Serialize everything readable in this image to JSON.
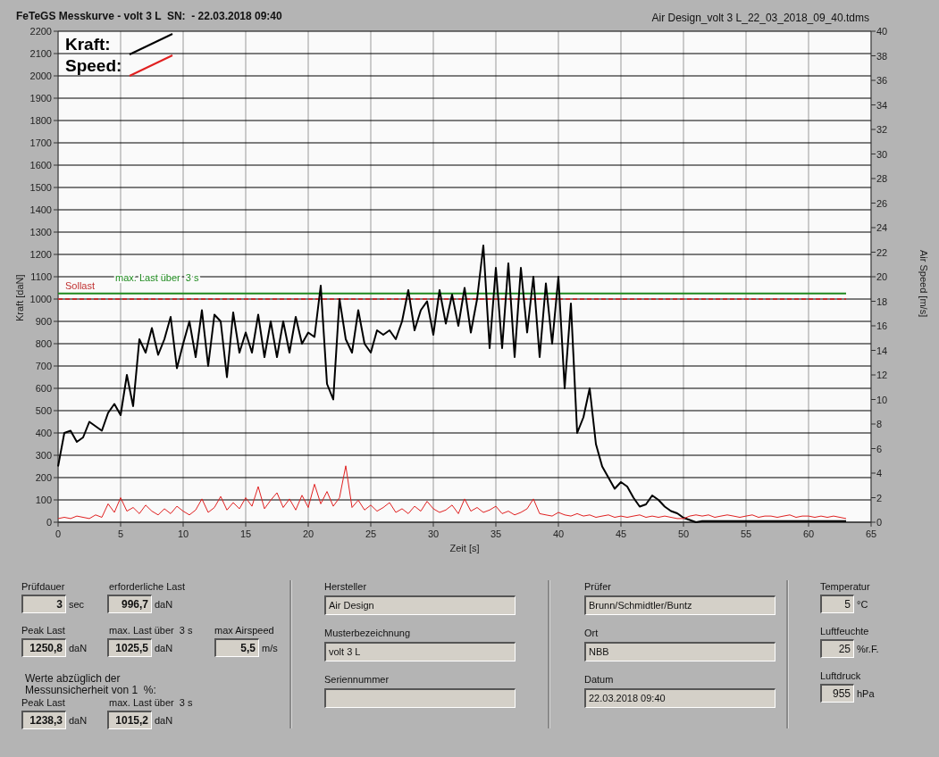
{
  "header": {
    "title": "FeTeGS Messkurve - volt 3 L  SN:  - 22.03.2018 09:40",
    "file": "Air Design_volt 3 L_22_03_2018_09_40.tdms"
  },
  "chart": {
    "chart_data": {
      "type": "line",
      "xlabel": "Zeit [s]",
      "ylabel": "Kraft [daN]",
      "y2label": "Air Speed [m/s]",
      "xlim": [
        0,
        65
      ],
      "ylim": [
        0,
        2200
      ],
      "y2lim": [
        0,
        40
      ],
      "xticks": [
        0,
        5,
        10,
        15,
        20,
        25,
        30,
        35,
        40,
        45,
        50,
        55,
        60,
        65
      ],
      "yticks": [
        0,
        100,
        200,
        300,
        400,
        500,
        600,
        700,
        800,
        900,
        1000,
        1100,
        1200,
        1300,
        1400,
        1500,
        1600,
        1700,
        1800,
        1900,
        2000,
        2100,
        2200
      ],
      "y2ticks": [
        0,
        2,
        4,
        6,
        8,
        10,
        12,
        14,
        16,
        18,
        20,
        22,
        24,
        26,
        28,
        30,
        32,
        34,
        36,
        38,
        40
      ],
      "x": [
        0,
        0.5,
        1,
        1.5,
        2,
        2.5,
        3,
        3.5,
        4,
        4.5,
        5,
        5.5,
        6,
        6.5,
        7,
        7.5,
        8,
        8.5,
        9,
        9.5,
        10,
        10.5,
        11,
        11.5,
        12,
        12.5,
        13,
        13.5,
        14,
        14.5,
        15,
        15.5,
        16,
        16.5,
        17,
        17.5,
        18,
        18.5,
        19,
        19.5,
        20,
        20.5,
        21,
        21.5,
        22,
        22.5,
        23,
        23.5,
        24,
        24.5,
        25,
        25.5,
        26,
        26.5,
        27,
        27.5,
        28,
        28.5,
        29,
        29.5,
        30,
        30.5,
        31,
        31.5,
        32,
        32.5,
        33,
        33.5,
        34,
        34.5,
        35,
        35.5,
        36,
        36.5,
        37,
        37.5,
        38,
        38.5,
        39,
        39.5,
        40,
        40.5,
        41,
        41.5,
        42,
        42.5,
        43,
        43.5,
        44,
        44.5,
        45,
        45.5,
        46,
        46.5,
        47,
        47.5,
        48,
        48.5,
        49,
        49.5,
        50,
        50.5,
        51,
        51.5,
        52,
        52.5,
        53,
        53.5,
        54,
        54.5,
        55,
        55.5,
        56,
        56.5,
        57,
        57.5,
        58,
        58.5,
        59,
        59.5,
        60,
        60.5,
        61,
        61.5,
        62,
        62.5,
        63
      ],
      "series": [
        {
          "name": "Kraft:",
          "color": "#000000",
          "values": [
            250,
            400,
            410,
            360,
            380,
            450,
            430,
            410,
            490,
            530,
            480,
            660,
            520,
            820,
            760,
            870,
            750,
            820,
            920,
            690,
            800,
            900,
            740,
            950,
            700,
            930,
            900,
            650,
            940,
            760,
            850,
            760,
            930,
            740,
            900,
            740,
            900,
            760,
            920,
            800,
            850,
            830,
            1060,
            620,
            550,
            1000,
            820,
            760,
            950,
            800,
            760,
            860,
            840,
            860,
            820,
            900,
            1040,
            860,
            950,
            990,
            840,
            1040,
            890,
            1020,
            880,
            1050,
            850,
            1000,
            1240,
            780,
            1140,
            780,
            1160,
            740,
            1140,
            850,
            1100,
            740,
            1070,
            800,
            1100,
            600,
            980,
            400,
            470,
            600,
            350,
            250,
            200,
            150,
            180,
            160,
            110,
            70,
            80,
            120,
            100,
            70,
            50,
            40,
            20,
            10,
            0,
            5,
            5,
            5,
            5,
            5,
            5,
            5,
            5,
            5,
            5,
            5,
            5,
            5,
            5,
            5,
            5,
            5,
            5,
            5,
            5,
            5,
            5,
            5,
            5
          ]
        },
        {
          "name": "Speed:",
          "color": "#e02020",
          "axis": "y2",
          "values": [
            0.3,
            0.4,
            0.3,
            0.5,
            0.4,
            0.3,
            0.6,
            0.4,
            1.5,
            0.8,
            2.0,
            0.9,
            1.2,
            0.7,
            1.4,
            0.9,
            0.6,
            1.1,
            0.7,
            1.3,
            0.9,
            0.6,
            1.0,
            1.9,
            0.8,
            1.2,
            2.1,
            1.0,
            1.6,
            1.1,
            2.0,
            1.3,
            2.9,
            1.1,
            1.8,
            2.4,
            1.2,
            1.9,
            1.0,
            2.2,
            1.2,
            3.1,
            1.5,
            2.5,
            1.3,
            2.0,
            4.6,
            1.2,
            1.8,
            1.0,
            1.4,
            0.9,
            1.2,
            1.6,
            0.8,
            1.1,
            0.7,
            1.3,
            0.9,
            1.7,
            1.1,
            0.8,
            1.0,
            1.4,
            0.7,
            1.9,
            0.9,
            1.2,
            0.8,
            1.0,
            1.3,
            0.7,
            0.9,
            0.6,
            0.8,
            1.1,
            1.9,
            0.7,
            0.6,
            0.5,
            0.8,
            0.6,
            0.5,
            0.7,
            0.5,
            0.6,
            0.4,
            0.5,
            0.6,
            0.4,
            0.5,
            0.4,
            0.5,
            0.6,
            0.4,
            0.5,
            0.4,
            0.5,
            0.4,
            0.3,
            0.3,
            0.5,
            0.6,
            0.5,
            0.6,
            0.4,
            0.5,
            0.6,
            0.5,
            0.4,
            0.5,
            0.6,
            0.4,
            0.5,
            0.5,
            0.4,
            0.5,
            0.6,
            0.4,
            0.5,
            0.5,
            0.4,
            0.5,
            0.4,
            0.5,
            0.4,
            0.3
          ]
        },
        {
          "name": "max. Last über  3 s",
          "color": "#1e8a1e",
          "values": [
            1025,
            1025,
            1025,
            1025,
            1025,
            1025,
            1025,
            1025,
            1025,
            1025,
            1025,
            1025,
            1025,
            1025,
            1025,
            1025,
            1025,
            1025,
            1025,
            1025,
            1025,
            1025,
            1025,
            1025,
            1025,
            1025,
            1025,
            1025,
            1025,
            1025,
            1025,
            1025,
            1025,
            1025,
            1025,
            1025,
            1025,
            1025,
            1025,
            1025,
            1025,
            1025,
            1025,
            1025,
            1025,
            1025,
            1025,
            1025,
            1025,
            1025,
            1025,
            1025,
            1025,
            1025,
            1025,
            1025,
            1025,
            1025,
            1025,
            1025,
            1025,
            1025,
            1025,
            1025,
            1025,
            1025,
            1025,
            1025,
            1025,
            1025,
            1025,
            1025,
            1025,
            1025,
            1025,
            1025,
            1025,
            1025,
            1025,
            1025,
            1025,
            1025,
            1025,
            1025,
            1025,
            1025,
            1025,
            1025,
            1025,
            1025,
            1025,
            1025,
            1025,
            1025,
            1025,
            1025,
            1025,
            1025,
            1025,
            1025,
            1025,
            1025,
            1025,
            1025,
            1025,
            1025,
            1025,
            1025,
            1025,
            1025,
            1025,
            1025,
            1025,
            1025,
            1025,
            1025,
            1025,
            1025,
            1025,
            1025,
            1025,
            1025,
            1025,
            1025,
            1025,
            1025,
            1025
          ]
        },
        {
          "name": "Sollast",
          "color": "#c03030",
          "line_style": "dashed",
          "values": [
            1000,
            1000,
            1000,
            1000,
            1000,
            1000,
            1000,
            1000,
            1000,
            1000,
            1000,
            1000,
            1000,
            1000,
            1000,
            1000,
            1000,
            1000,
            1000,
            1000,
            1000,
            1000,
            1000,
            1000,
            1000,
            1000,
            1000,
            1000,
            1000,
            1000,
            1000,
            1000,
            1000,
            1000,
            1000,
            1000,
            1000,
            1000,
            1000,
            1000,
            1000,
            1000,
            1000,
            1000,
            1000,
            1000,
            1000,
            1000,
            1000,
            1000,
            1000,
            1000,
            1000,
            1000,
            1000,
            1000,
            1000,
            1000,
            1000,
            1000,
            1000,
            1000,
            1000,
            1000,
            1000,
            1000,
            1000,
            1000,
            1000,
            1000,
            1000,
            1000,
            1000,
            1000,
            1000,
            1000,
            1000,
            1000,
            1000,
            1000,
            1000,
            1000,
            1000,
            1000,
            1000,
            1000,
            1000,
            1000,
            1000,
            1000,
            1000,
            1000,
            1000,
            1000,
            1000,
            1000,
            1000,
            1000,
            1000,
            1000,
            1000,
            1000,
            1000,
            1000,
            1000,
            1000,
            1000,
            1000,
            1000,
            1000,
            1000,
            1000,
            1000,
            1000,
            1000,
            1000,
            1000,
            1000,
            1000,
            1000,
            1000,
            1000,
            1000,
            1000,
            1000,
            1000,
            1000
          ]
        }
      ],
      "grid": true,
      "legend": "upper left"
    }
  },
  "results": {
    "rows": [
      [
        {
          "label": "Prüfdauer",
          "value": "3",
          "unit": "sec"
        },
        {
          "label": "erforderliche Last",
          "value": "996,7",
          "unit": "daN"
        }
      ],
      [
        {
          "label": "Peak Last",
          "value": "1250,8",
          "unit": "daN"
        },
        {
          "label": "max. Last über  3 s",
          "value": "1025,5",
          "unit": "daN"
        },
        {
          "label": "max Airspeed",
          "value": "5,5",
          "unit": "m/s"
        }
      ]
    ],
    "note": [
      "Werte abzüglich der",
      "Messunsicherheit von 1  %:"
    ],
    "corrected": [
      {
        "label": "Peak Last",
        "value": "1238,3",
        "unit": "daN"
      },
      {
        "label": "max. Last über  3 s",
        "value": "1015,2",
        "unit": "daN"
      }
    ]
  },
  "info_left": [
    {
      "label": "Hersteller",
      "value": "Air Design"
    },
    {
      "label": "Musterbezeichnung",
      "value": "volt 3 L"
    },
    {
      "label": "Seriennummer"
    }
  ],
  "info_right": [
    {
      "label": "Prüfer",
      "value": "Brunn/Schmidtler/Buntz"
    },
    {
      "label": "Ort",
      "value": "NBB"
    },
    {
      "label": "Datum",
      "value": "22.03.2018 09:40"
    }
  ],
  "conditions": [
    {
      "label": "Temperatur",
      "value": "5",
      "unit": "°C"
    },
    {
      "label": "Luftfeuchte",
      "value": "25",
      "unit": "%r.F."
    },
    {
      "label": "Luftdruck",
      "value": "955",
      "unit": "hPa"
    }
  ]
}
